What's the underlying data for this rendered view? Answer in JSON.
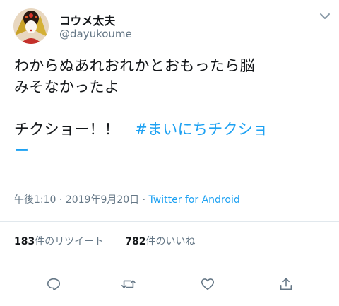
{
  "tweet": {
    "display_name": "コウメ太夫",
    "handle": "@dayukoume",
    "body_lines": [
      "わからぬあれおれかとおもったら脳",
      "みそなかったよ",
      "",
      "チクショー！！"
    ],
    "hashtag_part1": "#まいにちチクショ",
    "hashtag_part2": "ー",
    "time": "午後1:10",
    "sep": "·",
    "date": "2019年9月20日",
    "source": "Twitter for Android",
    "retweet_count": "183",
    "retweet_label": "件のリツイート",
    "like_count": "782",
    "like_label": "件のいいね"
  },
  "icons": [
    "reply-icon",
    "retweet-icon",
    "like-icon",
    "share-icon",
    "chevron-down-icon"
  ],
  "colors": {
    "link": "#1da1f2",
    "muted": "#657786",
    "text": "#14171a"
  }
}
